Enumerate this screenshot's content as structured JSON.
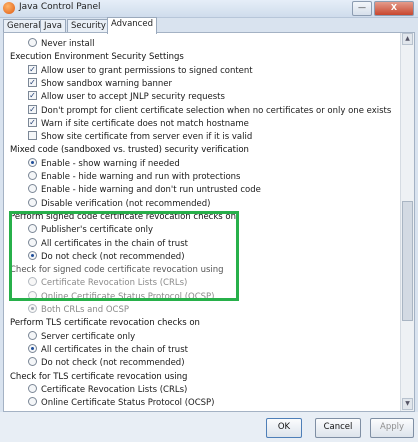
{
  "window": {
    "title": "Java Control Panel",
    "minimize_glyph": "—",
    "close_glyph": "X"
  },
  "tabs": [
    "General",
    "Java",
    "Security",
    "Advanced"
  ],
  "active_tab": "Advanced",
  "list": [
    {
      "kind": "radio",
      "label": "Never install",
      "checked": false,
      "indent": 2,
      "disabled": false
    },
    {
      "kind": "heading",
      "label": "Execution Environment Security Settings",
      "indent": 1
    },
    {
      "kind": "checkbox",
      "label": "Allow user to grant permissions to signed content",
      "checked": true,
      "indent": 2
    },
    {
      "kind": "checkbox",
      "label": "Show sandbox warning banner",
      "checked": true,
      "indent": 2
    },
    {
      "kind": "checkbox",
      "label": "Allow user to accept JNLP security requests",
      "checked": true,
      "indent": 2
    },
    {
      "kind": "checkbox",
      "label": "Don't prompt for client certificate selection when no certificates or only one exists",
      "checked": true,
      "indent": 2
    },
    {
      "kind": "checkbox",
      "label": "Warn if site certificate does not match hostname",
      "checked": true,
      "indent": 2
    },
    {
      "kind": "checkbox",
      "label": "Show site certificate from server even if it is valid",
      "checked": false,
      "indent": 2
    },
    {
      "kind": "heading",
      "label": "Mixed code (sandboxed vs. trusted) security verification",
      "indent": 1
    },
    {
      "kind": "radio",
      "label": "Enable - show warning if needed",
      "checked": true,
      "indent": 2
    },
    {
      "kind": "radio",
      "label": "Enable - hide warning and run with protections",
      "checked": false,
      "indent": 2
    },
    {
      "kind": "radio",
      "label": "Enable - hide warning and don't run untrusted code",
      "checked": false,
      "indent": 2
    },
    {
      "kind": "radio",
      "label": "Disable verification (not recommended)",
      "checked": false,
      "indent": 2
    },
    {
      "kind": "heading",
      "label": "Perform signed code certificate revocation checks on",
      "indent": 1
    },
    {
      "kind": "radio",
      "label": "Publisher's certificate only",
      "checked": false,
      "indent": 2
    },
    {
      "kind": "radio",
      "label": "All certificates in the chain of trust",
      "checked": false,
      "indent": 2
    },
    {
      "kind": "radio",
      "label": "Do not check (not recommended)",
      "checked": true,
      "indent": 2
    },
    {
      "kind": "heading",
      "label": "Check for signed code certificate revocation using",
      "indent": 1,
      "disabled": true
    },
    {
      "kind": "radio",
      "label": "Certificate Revocation Lists (CRLs)",
      "checked": false,
      "indent": 2,
      "disabled": true
    },
    {
      "kind": "radio",
      "label": "Online Certificate Status Protocol (OCSP)",
      "checked": false,
      "indent": 2,
      "disabled": true
    },
    {
      "kind": "radio",
      "label": "Both CRLs and OCSP",
      "checked": true,
      "indent": 2,
      "disabled": true
    },
    {
      "kind": "heading",
      "label": "Perform TLS certificate revocation checks on",
      "indent": 1
    },
    {
      "kind": "radio",
      "label": "Server certificate only",
      "checked": false,
      "indent": 2
    },
    {
      "kind": "radio",
      "label": "All certificates in the chain of trust",
      "checked": true,
      "indent": 2
    },
    {
      "kind": "radio",
      "label": "Do not check (not recommended)",
      "checked": false,
      "indent": 2
    },
    {
      "kind": "heading",
      "label": "Check for TLS certificate revocation using",
      "indent": 1
    },
    {
      "kind": "radio",
      "label": "Certificate Revocation Lists (CRLs)",
      "checked": false,
      "indent": 2
    },
    {
      "kind": "radio",
      "label": "Online Certificate Status Protocol (OCSP)",
      "checked": false,
      "indent": 2
    }
  ],
  "highlight_color": "#27b04a",
  "buttons": {
    "ok": "OK",
    "cancel": "Cancel",
    "apply": "Apply"
  }
}
